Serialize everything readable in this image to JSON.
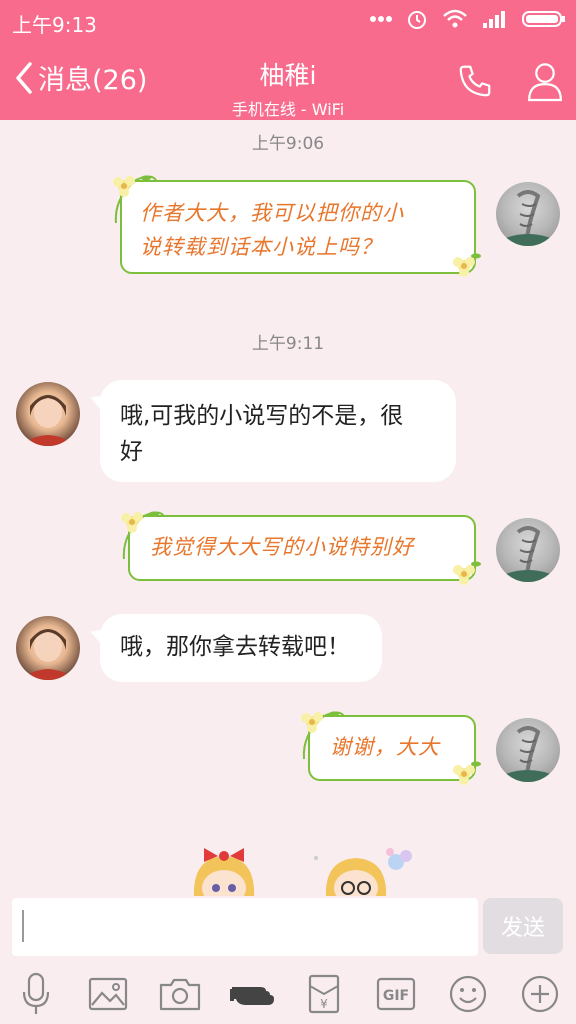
{
  "status_bar": {
    "time": "上午9:13"
  },
  "header": {
    "back_label": "消息(26)",
    "contact_name": "柚稚i",
    "status": "手机在线 - WiFi"
  },
  "messages": [
    {
      "timestamp": "上午9:06"
    },
    {
      "direction": "out",
      "text_line1": "作者大大，我可以把你的小",
      "text_line2": "说转载到话本小说上吗？"
    },
    {
      "timestamp": "上午9:11"
    },
    {
      "direction": "in",
      "text_line1": "哦,可我的小说写的不是，很",
      "text_line2": "好"
    },
    {
      "direction": "out",
      "text": "我觉得大大写的小说特别好"
    },
    {
      "direction": "in",
      "text": "哦，那你拿去转载吧！"
    },
    {
      "direction": "out",
      "text": "谢谢，大大"
    }
  ],
  "input": {
    "placeholder": "",
    "send_label": "发送"
  },
  "toolbar": {
    "gif_label": "GIF",
    "redpacket_label": "¥"
  },
  "colors": {
    "header": "#f86b8d",
    "bg": "#f9edf0",
    "bubble_border": "#7cbf3c",
    "floral_text": "#e8772e"
  }
}
